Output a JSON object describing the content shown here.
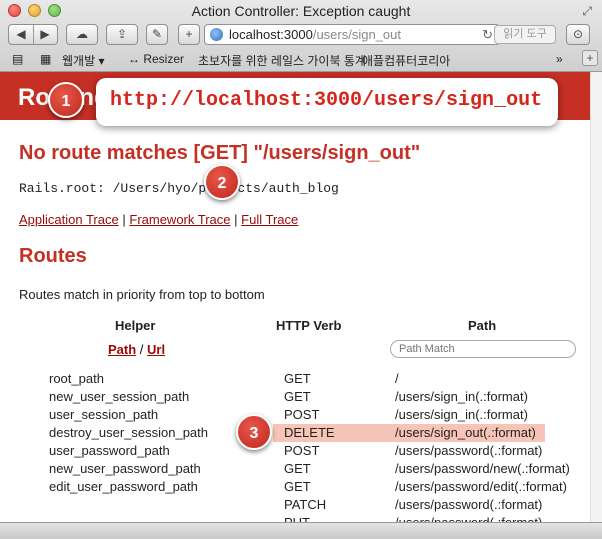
{
  "window": {
    "title": "Action Controller: Exception caught"
  },
  "toolbar": {
    "back_glyph": "◀",
    "forward_glyph": "▶",
    "cloud_glyph": "☁",
    "share_glyph": "⇪",
    "prefs_glyph": "✎",
    "add_glyph": "+",
    "address_host": "localhost:3000",
    "address_path": "/users/sign_out",
    "reload_glyph": "↻",
    "reader_label": "읽기 도구",
    "download_glyph": "⊙"
  },
  "bookmarks": {
    "book_glyph": "▤",
    "grid_glyph": "▦",
    "items": [
      "웹개발 ▾",
      "↔ Resizer",
      "초보자를 위한 레일스 가이북 통계",
      "애플컴퓨터코리아"
    ],
    "more_glyph": "»",
    "plus_glyph": "+"
  },
  "page": {
    "header": "Routing Error",
    "error_title": "No route matches [GET] \"/users/sign_out\"",
    "rails_root": "Rails.root: /Users/hyo/projects/auth_blog",
    "traces": {
      "application": "Application Trace",
      "framework": "Framework Trace",
      "full": "Full Trace",
      "separator": "|"
    },
    "routes_heading": "Routes",
    "routes_desc": "Routes match in priority from top to bottom",
    "columns": {
      "helper": "Helper",
      "verb": "HTTP Verb",
      "path": "Path"
    },
    "path_link": "Path",
    "url_link": "Url",
    "slash": "/",
    "path_match_placeholder": "Path Match",
    "routes": [
      {
        "helper": "root_path",
        "verb": "GET",
        "path": "/"
      },
      {
        "helper": "new_user_session_path",
        "verb": "GET",
        "path": "/users/sign_in(.:format)"
      },
      {
        "helper": "user_session_path",
        "verb": "POST",
        "path": "/users/sign_in(.:format)"
      },
      {
        "helper": "destroy_user_session_path",
        "verb": "DELETE",
        "path": "/users/sign_out(.:format)"
      },
      {
        "helper": "user_password_path",
        "verb": "POST",
        "path": "/users/password(.:format)"
      },
      {
        "helper": "new_user_password_path",
        "verb": "GET",
        "path": "/users/password/new(.:format)"
      },
      {
        "helper": "edit_user_password_path",
        "verb": "GET",
        "path": "/users/password/edit(.:format)"
      },
      {
        "helper": "",
        "verb": "PATCH",
        "path": "/users/password(.:format)"
      },
      {
        "helper": "",
        "verb": "PUT",
        "path": "/users/password(.:format)"
      }
    ]
  },
  "annotations": {
    "callout_url": "http://localhost:3000/users/sign_out",
    "badges": [
      "1",
      "2",
      "3"
    ]
  },
  "colors": {
    "rails_red": "#c52f24",
    "link_red": "#980905",
    "highlight": "#f7c4b8",
    "badge_red": "#c0281d"
  }
}
